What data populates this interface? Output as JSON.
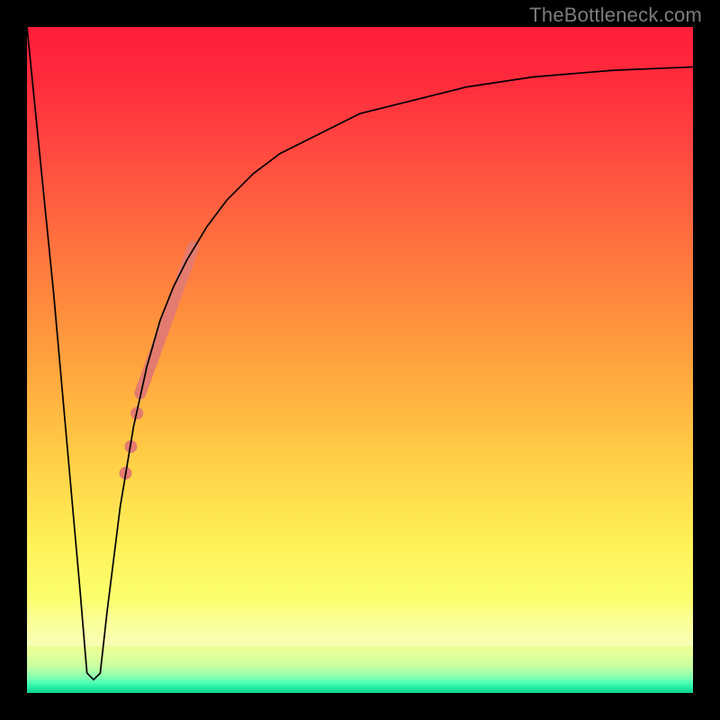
{
  "watermark": "TheBottleneck.com",
  "chart_data": {
    "type": "line",
    "title": "",
    "xlabel": "",
    "ylabel": "",
    "xlim": [
      0,
      100
    ],
    "ylim": [
      0,
      100
    ],
    "grid": false,
    "legend": false,
    "background_gradient": {
      "direction": "vertical",
      "stops": [
        {
          "pos": 0,
          "color": "#ff1d3a"
        },
        {
          "pos": 50,
          "color": "#ffad3f"
        },
        {
          "pos": 80,
          "color": "#fff25a"
        },
        {
          "pos": 96,
          "color": "#c8ffa1"
        },
        {
          "pos": 100,
          "color": "#14cf8d"
        }
      ]
    },
    "series": [
      {
        "name": "bottleneck-curve",
        "color": "#000000",
        "stroke_width": 1.7,
        "x": [
          0,
          4,
          8,
          9,
          10,
          11,
          12,
          14,
          16,
          18,
          20,
          22,
          24,
          27,
          30,
          34,
          38,
          44,
          50,
          58,
          66,
          76,
          88,
          100
        ],
        "y": [
          100,
          60,
          15,
          3,
          2,
          3,
          12,
          28,
          40,
          49,
          56,
          61,
          65,
          70,
          74,
          78,
          81,
          84,
          87,
          89,
          91,
          92.5,
          93.5,
          94
        ]
      }
    ],
    "highlight_segment": {
      "name": "highlighted-range",
      "color": "#e47b6f",
      "stroke_width_main": 13,
      "x": [
        17,
        25
      ],
      "y": [
        45,
        67
      ]
    },
    "highlight_dots": {
      "name": "highlight-dots",
      "color": "#e47b6f",
      "radius": 7,
      "points": [
        {
          "x": 16.5,
          "y": 42
        },
        {
          "x": 15.6,
          "y": 37
        },
        {
          "x": 14.8,
          "y": 33
        }
      ]
    }
  }
}
